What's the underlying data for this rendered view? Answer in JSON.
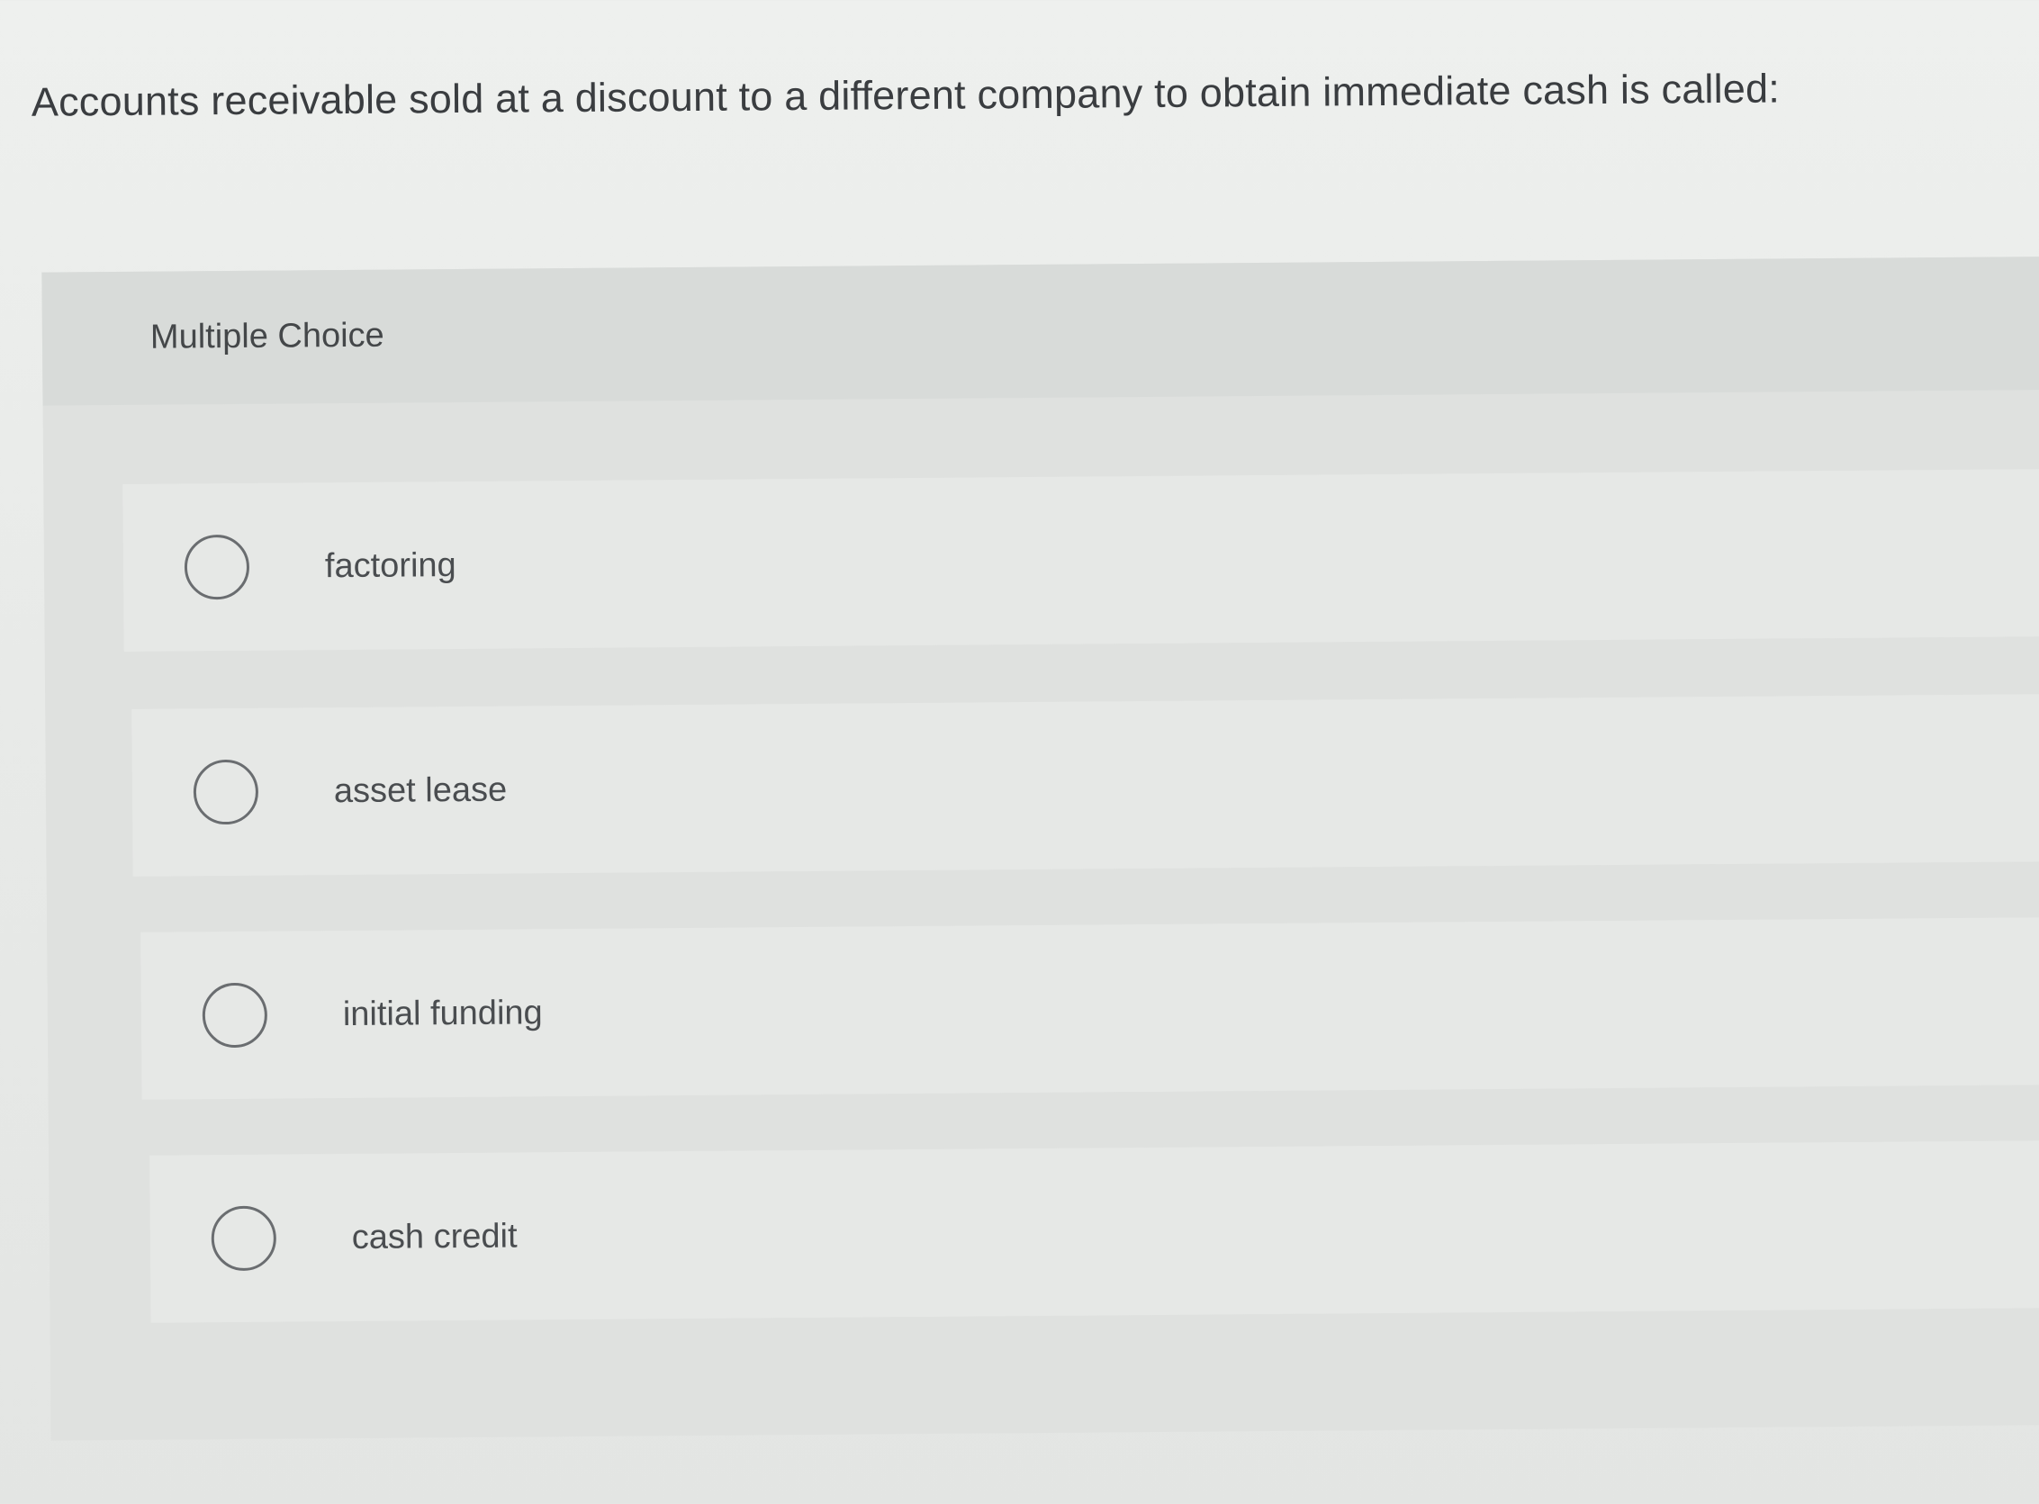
{
  "question": {
    "text": "Accounts receivable sold at a discount to a different company to obtain immediate cash is called:"
  },
  "multiple_choice": {
    "title": "Multiple Choice",
    "options": [
      {
        "label": "factoring",
        "selected": false
      },
      {
        "label": "asset lease",
        "selected": false
      },
      {
        "label": "initial funding",
        "selected": false
      },
      {
        "label": "cash credit",
        "selected": false
      }
    ]
  }
}
